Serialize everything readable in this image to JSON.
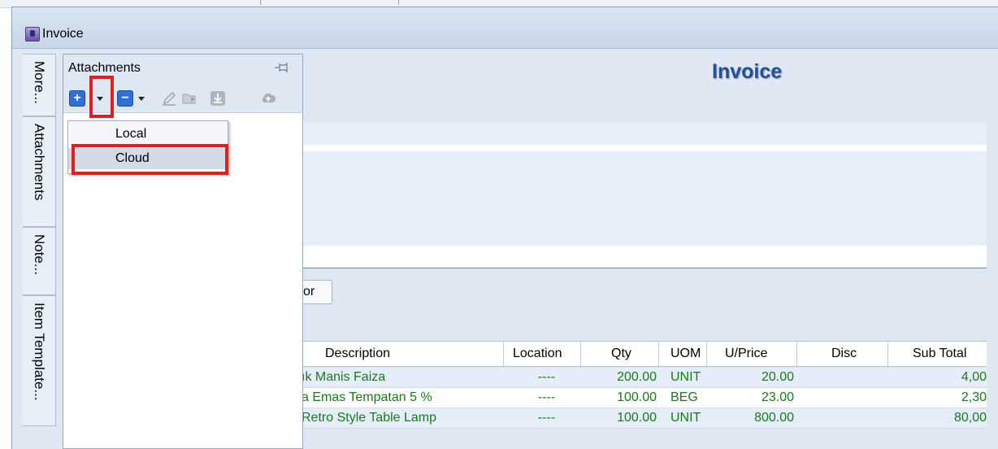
{
  "window": {
    "title": "Invoice"
  },
  "side_tabs": [
    "More...",
    "Attachments",
    "Note...",
    "Item Template..."
  ],
  "attachments": {
    "title": "Attachments",
    "toolbar": {
      "add_label": "+",
      "remove_label": "−",
      "icons": [
        "add-icon",
        "dropdown-arrow-icon",
        "remove-icon",
        "dropdown-arrow-icon",
        "edit-pencil-icon",
        "open-folder-icon",
        "download-icon",
        "cloud-upload-icon"
      ]
    },
    "add_menu": {
      "items": [
        "Local",
        "Cloud"
      ],
      "highlighted": "Cloud"
    }
  },
  "main": {
    "title": "Invoice",
    "partial_button": "or"
  },
  "grid": {
    "columns": [
      "Description",
      "Location",
      "Qty",
      "UOM",
      "U/Price",
      "Disc",
      "Sub Total"
    ],
    "rows": [
      {
        "description": "ık Manis Faiza",
        "location": "----",
        "qty": "200.00",
        "uom": "UNIT",
        "uprice": "20.00",
        "disc": "",
        "subtotal": "4,00"
      },
      {
        "description": "a Emas Tempatan 5 %",
        "location": "----",
        "qty": "100.00",
        "uom": "BEG",
        "uprice": "23.00",
        "disc": "",
        "subtotal": "2,30"
      },
      {
        "description": "Retro Style Table Lamp",
        "location": "----",
        "qty": "100.00",
        "uom": "UNIT",
        "uprice": "800.00",
        "disc": "",
        "subtotal": "80,00"
      }
    ]
  },
  "colors": {
    "title_blue": "#24509a",
    "row_text_green": "#1a7a1a",
    "highlight_red": "#e0201e",
    "button_blue": "#2f6fd6"
  }
}
